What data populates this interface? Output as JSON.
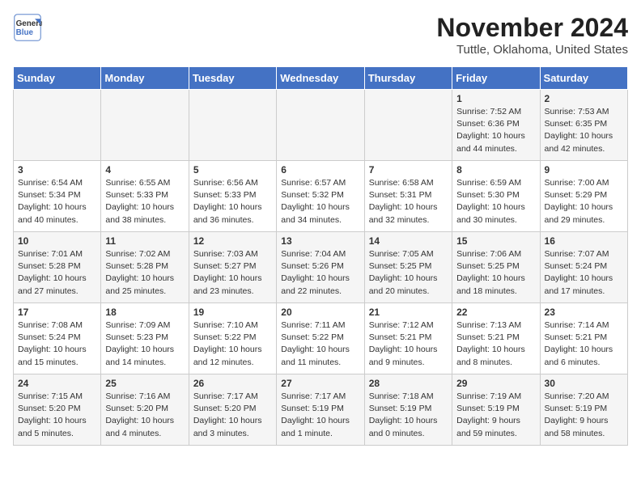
{
  "header": {
    "logo_line1": "General",
    "logo_line2": "Blue",
    "title": "November 2024",
    "location": "Tuttle, Oklahoma, United States"
  },
  "days_of_week": [
    "Sunday",
    "Monday",
    "Tuesday",
    "Wednesday",
    "Thursday",
    "Friday",
    "Saturday"
  ],
  "weeks": [
    [
      {
        "day": "",
        "info": ""
      },
      {
        "day": "",
        "info": ""
      },
      {
        "day": "",
        "info": ""
      },
      {
        "day": "",
        "info": ""
      },
      {
        "day": "",
        "info": ""
      },
      {
        "day": "1",
        "info": "Sunrise: 7:52 AM\nSunset: 6:36 PM\nDaylight: 10 hours and 44 minutes."
      },
      {
        "day": "2",
        "info": "Sunrise: 7:53 AM\nSunset: 6:35 PM\nDaylight: 10 hours and 42 minutes."
      }
    ],
    [
      {
        "day": "3",
        "info": "Sunrise: 6:54 AM\nSunset: 5:34 PM\nDaylight: 10 hours and 40 minutes."
      },
      {
        "day": "4",
        "info": "Sunrise: 6:55 AM\nSunset: 5:33 PM\nDaylight: 10 hours and 38 minutes."
      },
      {
        "day": "5",
        "info": "Sunrise: 6:56 AM\nSunset: 5:33 PM\nDaylight: 10 hours and 36 minutes."
      },
      {
        "day": "6",
        "info": "Sunrise: 6:57 AM\nSunset: 5:32 PM\nDaylight: 10 hours and 34 minutes."
      },
      {
        "day": "7",
        "info": "Sunrise: 6:58 AM\nSunset: 5:31 PM\nDaylight: 10 hours and 32 minutes."
      },
      {
        "day": "8",
        "info": "Sunrise: 6:59 AM\nSunset: 5:30 PM\nDaylight: 10 hours and 30 minutes."
      },
      {
        "day": "9",
        "info": "Sunrise: 7:00 AM\nSunset: 5:29 PM\nDaylight: 10 hours and 29 minutes."
      }
    ],
    [
      {
        "day": "10",
        "info": "Sunrise: 7:01 AM\nSunset: 5:28 PM\nDaylight: 10 hours and 27 minutes."
      },
      {
        "day": "11",
        "info": "Sunrise: 7:02 AM\nSunset: 5:28 PM\nDaylight: 10 hours and 25 minutes."
      },
      {
        "day": "12",
        "info": "Sunrise: 7:03 AM\nSunset: 5:27 PM\nDaylight: 10 hours and 23 minutes."
      },
      {
        "day": "13",
        "info": "Sunrise: 7:04 AM\nSunset: 5:26 PM\nDaylight: 10 hours and 22 minutes."
      },
      {
        "day": "14",
        "info": "Sunrise: 7:05 AM\nSunset: 5:25 PM\nDaylight: 10 hours and 20 minutes."
      },
      {
        "day": "15",
        "info": "Sunrise: 7:06 AM\nSunset: 5:25 PM\nDaylight: 10 hours and 18 minutes."
      },
      {
        "day": "16",
        "info": "Sunrise: 7:07 AM\nSunset: 5:24 PM\nDaylight: 10 hours and 17 minutes."
      }
    ],
    [
      {
        "day": "17",
        "info": "Sunrise: 7:08 AM\nSunset: 5:24 PM\nDaylight: 10 hours and 15 minutes."
      },
      {
        "day": "18",
        "info": "Sunrise: 7:09 AM\nSunset: 5:23 PM\nDaylight: 10 hours and 14 minutes."
      },
      {
        "day": "19",
        "info": "Sunrise: 7:10 AM\nSunset: 5:22 PM\nDaylight: 10 hours and 12 minutes."
      },
      {
        "day": "20",
        "info": "Sunrise: 7:11 AM\nSunset: 5:22 PM\nDaylight: 10 hours and 11 minutes."
      },
      {
        "day": "21",
        "info": "Sunrise: 7:12 AM\nSunset: 5:21 PM\nDaylight: 10 hours and 9 minutes."
      },
      {
        "day": "22",
        "info": "Sunrise: 7:13 AM\nSunset: 5:21 PM\nDaylight: 10 hours and 8 minutes."
      },
      {
        "day": "23",
        "info": "Sunrise: 7:14 AM\nSunset: 5:21 PM\nDaylight: 10 hours and 6 minutes."
      }
    ],
    [
      {
        "day": "24",
        "info": "Sunrise: 7:15 AM\nSunset: 5:20 PM\nDaylight: 10 hours and 5 minutes."
      },
      {
        "day": "25",
        "info": "Sunrise: 7:16 AM\nSunset: 5:20 PM\nDaylight: 10 hours and 4 minutes."
      },
      {
        "day": "26",
        "info": "Sunrise: 7:17 AM\nSunset: 5:20 PM\nDaylight: 10 hours and 3 minutes."
      },
      {
        "day": "27",
        "info": "Sunrise: 7:17 AM\nSunset: 5:19 PM\nDaylight: 10 hours and 1 minute."
      },
      {
        "day": "28",
        "info": "Sunrise: 7:18 AM\nSunset: 5:19 PM\nDaylight: 10 hours and 0 minutes."
      },
      {
        "day": "29",
        "info": "Sunrise: 7:19 AM\nSunset: 5:19 PM\nDaylight: 9 hours and 59 minutes."
      },
      {
        "day": "30",
        "info": "Sunrise: 7:20 AM\nSunset: 5:19 PM\nDaylight: 9 hours and 58 minutes."
      }
    ]
  ]
}
